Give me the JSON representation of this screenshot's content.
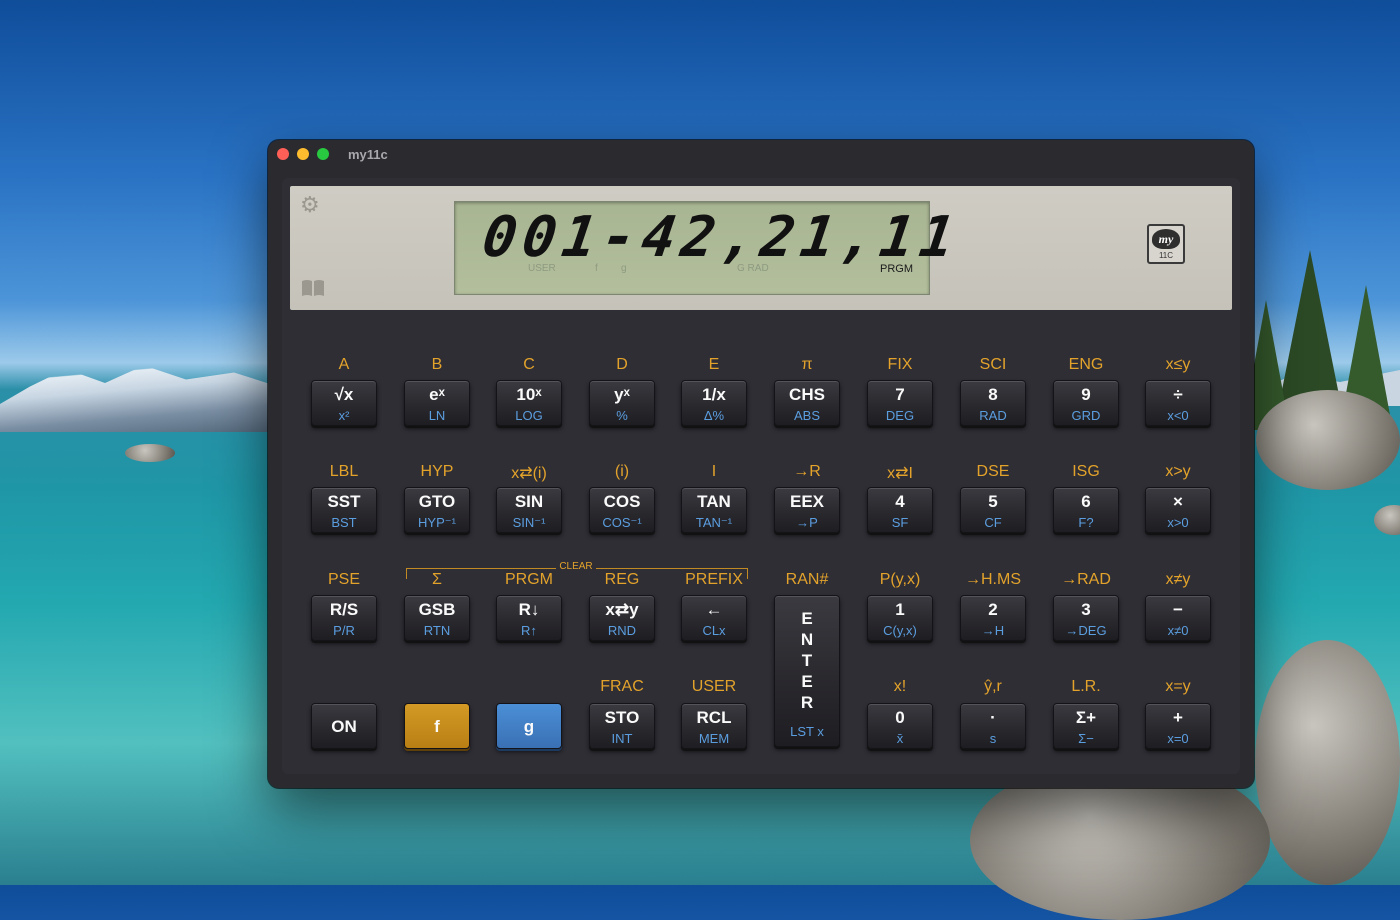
{
  "window": {
    "title": "my11c"
  },
  "display": {
    "digits": "001-42,21,11",
    "annunciators": [
      "USER",
      "f",
      "g",
      "G RAD",
      "PRGM"
    ]
  },
  "logo": {
    "top": "my",
    "bottom": "11C"
  },
  "clear_bracket": "CLEAR",
  "rows": [
    {
      "keys": [
        {
          "f": "A",
          "main": "√x",
          "g": "x²"
        },
        {
          "f": "B",
          "main": "eˣ",
          "g": "LN"
        },
        {
          "f": "C",
          "main": "10ˣ",
          "g": "LOG"
        },
        {
          "f": "D",
          "main": "yˣ",
          "g": "%"
        },
        {
          "f": "E",
          "main": "1/x",
          "g": "Δ%"
        },
        {
          "f": "π",
          "main": "CHS",
          "g": "ABS"
        },
        {
          "f": "FIX",
          "main": "7",
          "g": "DEG"
        },
        {
          "f": "SCI",
          "main": "8",
          "g": "RAD"
        },
        {
          "f": "ENG",
          "main": "9",
          "g": "GRD"
        },
        {
          "f": "x≤y",
          "main": "÷",
          "g": "x<0"
        }
      ]
    },
    {
      "keys": [
        {
          "f": "LBL",
          "main": "SST",
          "g": "BST"
        },
        {
          "f": "HYP",
          "main": "GTO",
          "g": "HYP⁻¹"
        },
        {
          "f": "x⇄(i)",
          "main": "SIN",
          "g": "SIN⁻¹"
        },
        {
          "f": "(i)",
          "main": "COS",
          "g": "COS⁻¹"
        },
        {
          "f": "I",
          "main": "TAN",
          "g": "TAN⁻¹"
        },
        {
          "f": "→R",
          "main": "EEX",
          "g": "→P"
        },
        {
          "f": "x⇄I",
          "main": "4",
          "g": "SF"
        },
        {
          "f": "DSE",
          "main": "5",
          "g": "CF"
        },
        {
          "f": "ISG",
          "main": "6",
          "g": "F?"
        },
        {
          "f": "x>y",
          "main": "×",
          "g": "x>0"
        }
      ]
    },
    {
      "keys": [
        {
          "f": "PSE",
          "main": "R/S",
          "g": "P/R"
        },
        {
          "f": "Σ",
          "main": "GSB",
          "g": "RTN"
        },
        {
          "f": "PRGM",
          "main": "R↓",
          "g": "R↑"
        },
        {
          "f": "REG",
          "main": "x⇄y",
          "g": "RND"
        },
        {
          "f": "PREFIX",
          "main": "←",
          "g": "CLx"
        },
        {
          "f": "RAN#",
          "main": "ENTER",
          "g": "LST x"
        },
        {
          "f": "P(y,x)",
          "main": "1",
          "g": "C(y,x)"
        },
        {
          "f": "→H.MS",
          "main": "2",
          "g": "→H"
        },
        {
          "f": "→RAD",
          "main": "3",
          "g": "→DEG"
        },
        {
          "f": "x≠y",
          "main": "−",
          "g": "x≠0"
        }
      ]
    },
    {
      "keys": [
        {
          "f": "",
          "main": "ON",
          "g": ""
        },
        {
          "f": "",
          "main": "f",
          "g": ""
        },
        {
          "f": "",
          "main": "g",
          "g": ""
        },
        {
          "f": "FRAC",
          "main": "STO",
          "g": "INT"
        },
        {
          "f": "USER",
          "main": "RCL",
          "g": "MEM"
        },
        {
          "f": "x!",
          "main": "0",
          "g": "x̄"
        },
        {
          "f": "ŷ,r",
          "main": "·",
          "g": "s"
        },
        {
          "f": "L.R.",
          "main": "Σ+",
          "g": "Σ−"
        },
        {
          "f": "x=y",
          "main": "+",
          "g": "x=0"
        }
      ]
    }
  ]
}
